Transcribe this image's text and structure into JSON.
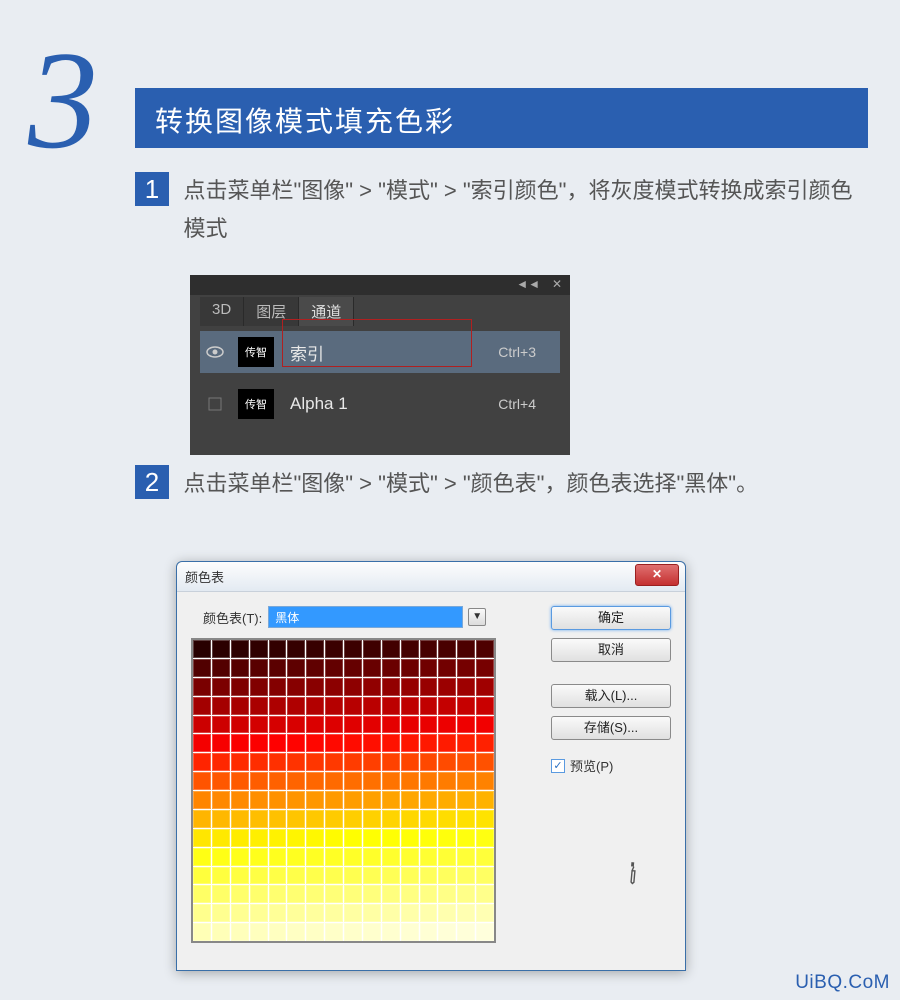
{
  "section": {
    "number": "3",
    "title": "转换图像模式填充色彩"
  },
  "steps": [
    {
      "num": "1",
      "text": "点击菜单栏\"图像\" > \"模式\" > \"索引颜色\"，将灰度模式转换成索引颜色模式"
    },
    {
      "num": "2",
      "text": "点击菜单栏\"图像\" > \"模式\" > \"颜色表\"，颜色表选择\"黑体\"。"
    }
  ],
  "channels_panel": {
    "tabs": [
      "3D",
      "图层",
      "通道"
    ],
    "active_tab": 2,
    "rows": [
      {
        "eye": true,
        "thumb": "传智",
        "name": "索引",
        "shortcut": "Ctrl+3"
      },
      {
        "eye": false,
        "thumb": "传智",
        "name": "Alpha 1",
        "shortcut": "Ctrl+4"
      }
    ]
  },
  "color_table_dialog": {
    "title": "颜色表",
    "dropdown_label": "颜色表(T):",
    "dropdown_value": "黑体",
    "buttons": {
      "ok": "确定",
      "cancel": "取消",
      "load": "载入(L)...",
      "save": "存储(S)..."
    },
    "preview_label": "预览(P)",
    "preview_checked": true,
    "close_icon": "✕"
  },
  "watermark": "UiBQ.CoM"
}
